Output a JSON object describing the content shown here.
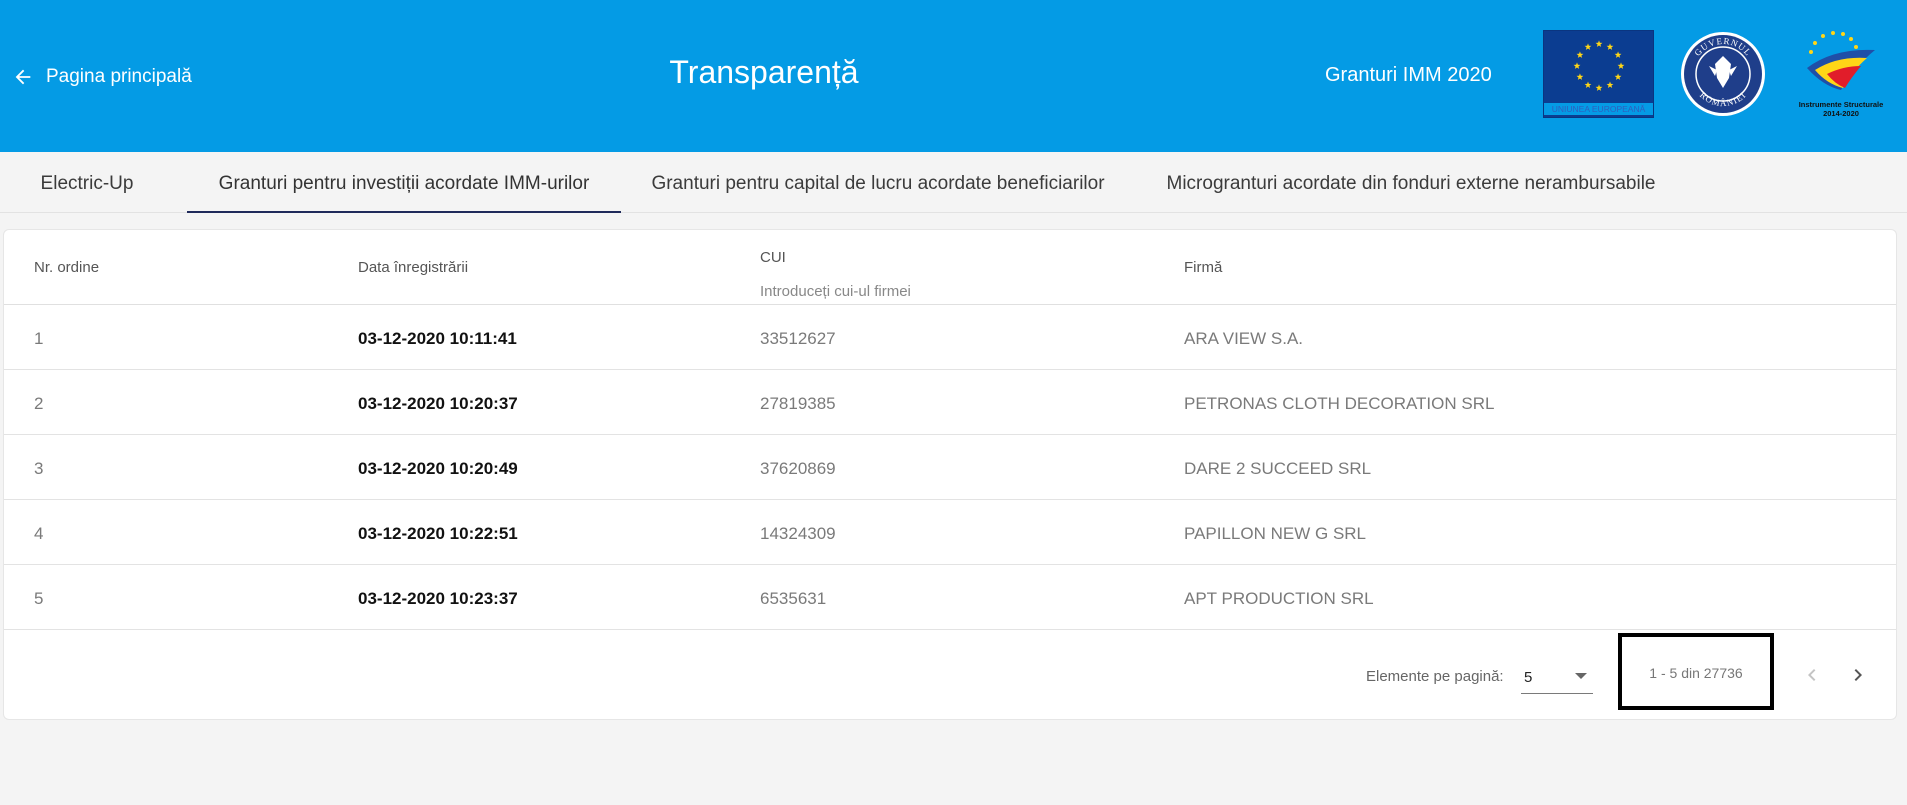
{
  "header": {
    "back_label": "Pagina principală",
    "title": "Transparență",
    "app_name": "Granturi IMM 2020",
    "eu_logo_text": "UNIUNEA EUROPEANĂ",
    "gov_logo_text": "GUVERNUL ROMÂNIEI",
    "is_logo_line1": "Instrumente Structurale",
    "is_logo_line2": "2014-2020"
  },
  "tabs": [
    {
      "label": "Electric-Up",
      "active": false
    },
    {
      "label": "Granturi pentru investiții acordate IMM-urilor",
      "active": true
    },
    {
      "label": "Granturi pentru capital de lucru acordate beneficiarilor",
      "active": false
    },
    {
      "label": "Microgranturi acordate din fonduri externe nerambursabile",
      "active": false
    }
  ],
  "table": {
    "columns": {
      "order": "Nr. ordine",
      "date": "Data înregistrării",
      "cui": "CUI",
      "firm": "Firmă"
    },
    "cui_placeholder": "Introduceți cui-ul firmei",
    "rows": [
      {
        "order": "1",
        "date": "03-12-2020 10:11:41",
        "cui": "33512627",
        "firm": "ARA VIEW S.A."
      },
      {
        "order": "2",
        "date": "03-12-2020 10:20:37",
        "cui": "27819385",
        "firm": "PETRONAS CLOTH DECORATION SRL"
      },
      {
        "order": "3",
        "date": "03-12-2020 10:20:49",
        "cui": "37620869",
        "firm": "DARE 2 SUCCEED SRL"
      },
      {
        "order": "4",
        "date": "03-12-2020 10:22:51",
        "cui": "14324309",
        "firm": "PAPILLON NEW G SRL"
      },
      {
        "order": "5",
        "date": "03-12-2020 10:23:37",
        "cui": "6535631",
        "firm": "APT PRODUCTION SRL"
      }
    ]
  },
  "paginator": {
    "page_size_label": "Elemente pe pagină:",
    "page_size": "5",
    "range_label": "1 - 5 din 27736",
    "prev_icon": "chevron-left-icon",
    "next_icon": "chevron-right-icon"
  },
  "colors": {
    "header_bg": "#049be5",
    "active_tab_underline": "#1f2a5a"
  }
}
